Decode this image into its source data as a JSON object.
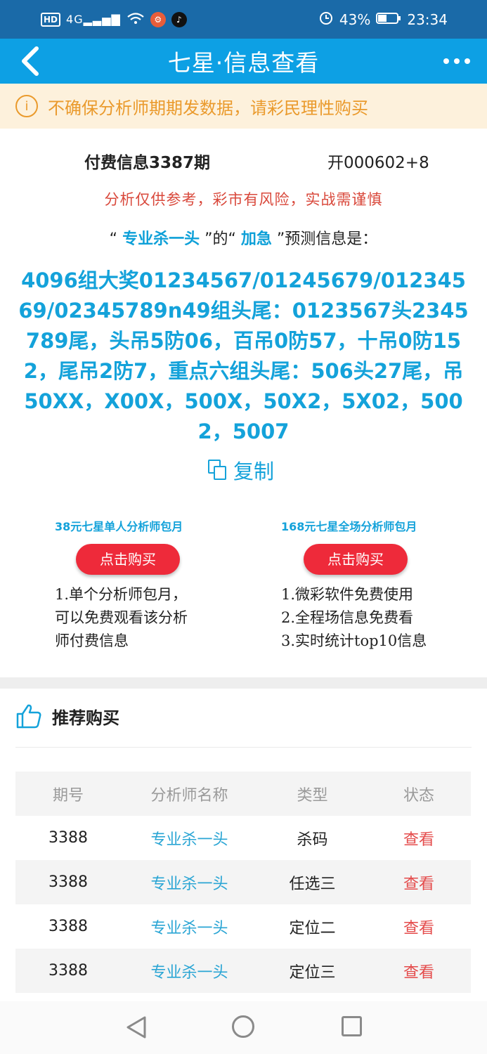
{
  "status_bar": {
    "hd": "HD",
    "signal": "4G",
    "battery": "43%",
    "time": "23:34",
    "icons": [
      "signal-icon",
      "wifi-icon",
      "app-badge-icon",
      "tiktok-icon",
      "alarm-icon",
      "battery-icon"
    ]
  },
  "nav": {
    "title": "七星·信息查看",
    "back_icon": "back-chevron-icon",
    "more_icon": "more-dots-icon"
  },
  "notice": {
    "icon_glyph": "i",
    "text": "不确保分析师期期发数据，请彩民理性购买"
  },
  "info": {
    "title": "付费信息3387期",
    "open_result": "开000602+8",
    "risk": "分析仅供参考，彩市有风险，实战需谨慎",
    "q1": "“",
    "analyst": "专业杀一头",
    "mid": "”的“",
    "category": "加急",
    "end": "”预测信息是：",
    "content": "4096组大奖01234567/01245679/01234569/02345789n49组头尾：0123567头2345789尾，头吊5防06，百吊0防57，十吊0防152，尾吊2防7，重点六组头尾：506头27尾，吊50XX，X00X，500X，50X2，5X02，5002，5007",
    "copy_label": "复制"
  },
  "plans": [
    {
      "title": "38元七星单人分析师包月",
      "button": "点击购买",
      "desc": [
        "1.单个分析师包月，",
        "可以免费观看该分析",
        "师付费信息"
      ]
    },
    {
      "title": "168元七星全场分析师包月",
      "button": "点击购买",
      "desc": [
        "1.微彩软件免费使用",
        "2.全程场信息免费看",
        "3.实时统计top10信息"
      ]
    }
  ],
  "recommend": {
    "title": "推荐购买",
    "icon": "thumbs-up-icon",
    "headers": [
      "期号",
      "分析师名称",
      "类型",
      "状态"
    ],
    "rows": [
      [
        "3388",
        "专业杀一头",
        "杀码",
        "查看"
      ],
      [
        "3388",
        "专业杀一头",
        "任选三",
        "查看"
      ],
      [
        "3388",
        "专业杀一头",
        "定位二",
        "查看"
      ],
      [
        "3388",
        "专业杀一头",
        "定位三",
        "查看"
      ]
    ]
  },
  "system_nav": {
    "icons": [
      "nav-back-triangle-icon",
      "nav-home-circle-icon",
      "nav-recent-square-icon"
    ]
  },
  "colors": {
    "status_bar": "#1a6aa8",
    "nav_bar": "#0da0e4",
    "notice_bg": "#fdf1dc",
    "notice_text": "#ea9a2c",
    "accent_blue": "#14a2da",
    "buy_red": "#ee2a3a",
    "risk_red": "#d9483b",
    "view_red": "#e44b4b"
  }
}
